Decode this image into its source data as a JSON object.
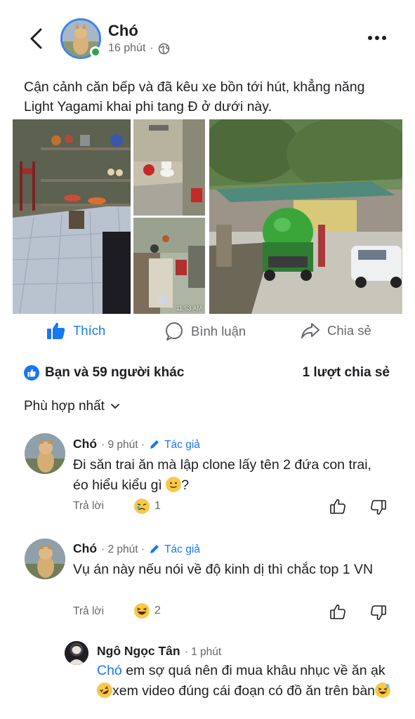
{
  "post": {
    "author": "Chó",
    "time": "16 phút",
    "separator": "·",
    "caption": "Cận cảnh căn bếp và đã kêu xe bồn tới hút, khẳng năng Light Yagami khai phi tang Đ ở dưới này.",
    "photo_timestamp": "11:53 AM"
  },
  "actions": {
    "like": "Thích",
    "comment": "Bình luận",
    "share": "Chia sẻ"
  },
  "summary": {
    "reactions": "Bạn và 59 người khác",
    "shares": "1 lượt chia sẻ"
  },
  "sort": {
    "label": "Phù hợp nhất"
  },
  "comments": [
    {
      "name": "Chó",
      "time": "· 9 phút ·",
      "author_tag": "Tác giả",
      "text": "Đi săn trai ăn mà lập clone lấy tên 2 đứa con trai, éo hiểu kiểu gì",
      "text_end": "?",
      "reply": "Trả lời",
      "reaction_count": "1"
    },
    {
      "name": "Chó",
      "time": "· 2 phút ·",
      "author_tag": "Tác giả",
      "text": "Vụ án này nếu nói về độ kinh dị thì chắc top 1 VN",
      "reply": "Trả lời",
      "reaction_count": "2"
    }
  ],
  "reply_comment": {
    "name": "Ngô Ngọc Tân",
    "time": "· 1 phút",
    "mention": "Chó",
    "text1": " em sợ quá nên đi mua khâu nhục về ăn ạk",
    "text2": "xem video đúng cái đoạn có đồ ăn trên bàn"
  },
  "colors": {
    "accent": "#1877f2",
    "secondary_text": "#65676b",
    "online": "#31a24c"
  }
}
